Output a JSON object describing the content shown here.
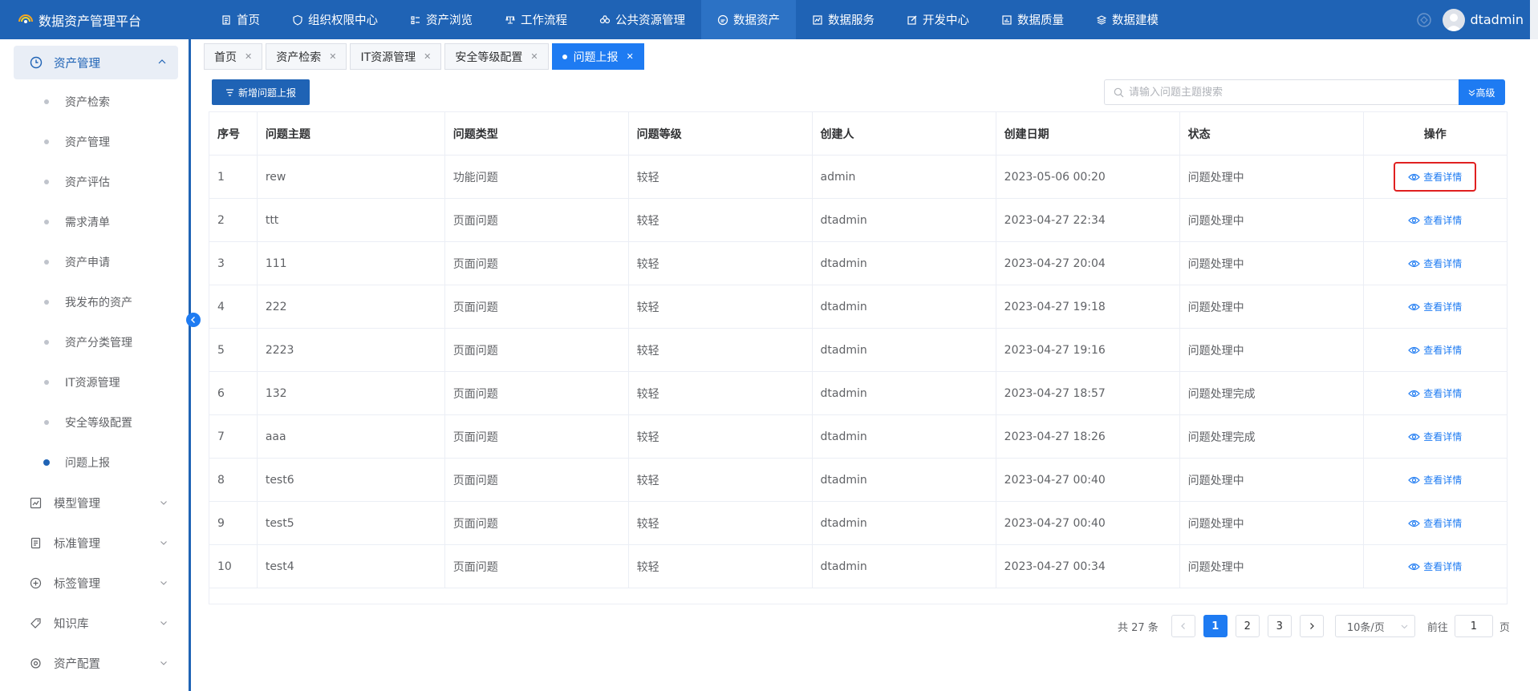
{
  "app": {
    "title": "数据资产管理平台"
  },
  "topnav": [
    {
      "label": "首页",
      "icon": "document-icon"
    },
    {
      "label": "组织权限中心",
      "icon": "shield-icon"
    },
    {
      "label": "资产浏览",
      "icon": "list-icon"
    },
    {
      "label": "工作流程",
      "icon": "flow-icon"
    },
    {
      "label": "公共资源管理",
      "icon": "resource-icon"
    },
    {
      "label": "数据资产",
      "icon": "asset-icon",
      "active": true
    },
    {
      "label": "数据服务",
      "icon": "service-icon"
    },
    {
      "label": "开发中心",
      "icon": "edit-icon"
    },
    {
      "label": "数据质量",
      "icon": "chart-icon"
    },
    {
      "label": "数据建模",
      "icon": "layers-icon"
    }
  ],
  "user": {
    "name": "dtadmin"
  },
  "sidebar": {
    "group": {
      "label": "资产管理",
      "icon": "clock-icon"
    },
    "sub_items": [
      "资产检索",
      "资产管理",
      "资产评估",
      "需求清单",
      "资产申请",
      "我发布的资产",
      "资产分类管理",
      "IT资源管理",
      "安全等级配置",
      "问题上报"
    ],
    "active_sub": "问题上报",
    "menus": [
      {
        "label": "模型管理",
        "icon": "trend-icon"
      },
      {
        "label": "标准管理",
        "icon": "doc-icon"
      },
      {
        "label": "标签管理",
        "icon": "plus-circle-icon"
      },
      {
        "label": "知识库",
        "icon": "tag-icon"
      },
      {
        "label": "资产配置",
        "icon": "settings-icon"
      }
    ]
  },
  "tabs": [
    {
      "label": "首页"
    },
    {
      "label": "资产检索"
    },
    {
      "label": "IT资源管理"
    },
    {
      "label": "安全等级配置"
    },
    {
      "label": "问题上报",
      "active": true
    }
  ],
  "toolbar": {
    "add_label": "新增问题上报",
    "search_placeholder": "请输入问题主题搜索",
    "advanced_label": "高级"
  },
  "table": {
    "headers": [
      "序号",
      "问题主题",
      "问题类型",
      "问题等级",
      "创建人",
      "创建日期",
      "状态",
      "操作"
    ],
    "action_label": "查看详情",
    "rows": [
      [
        "1",
        "rew",
        "功能问题",
        "较轻",
        "admin",
        "2023-05-06 00:20",
        "问题处理中"
      ],
      [
        "2",
        "ttt",
        "页面问题",
        "较轻",
        "dtadmin",
        "2023-04-27 22:34",
        "问题处理中"
      ],
      [
        "3",
        "111",
        "页面问题",
        "较轻",
        "dtadmin",
        "2023-04-27 20:04",
        "问题处理中"
      ],
      [
        "4",
        "222",
        "页面问题",
        "较轻",
        "dtadmin",
        "2023-04-27 19:18",
        "问题处理中"
      ],
      [
        "5",
        "2223",
        "页面问题",
        "较轻",
        "dtadmin",
        "2023-04-27 19:16",
        "问题处理中"
      ],
      [
        "6",
        "132",
        "页面问题",
        "较轻",
        "dtadmin",
        "2023-04-27 18:57",
        "问题处理完成"
      ],
      [
        "7",
        "aaa",
        "页面问题",
        "较轻",
        "dtadmin",
        "2023-04-27 18:26",
        "问题处理完成"
      ],
      [
        "8",
        "test6",
        "页面问题",
        "较轻",
        "dtadmin",
        "2023-04-27 00:40",
        "问题处理中"
      ],
      [
        "9",
        "test5",
        "页面问题",
        "较轻",
        "dtadmin",
        "2023-04-27 00:40",
        "问题处理中"
      ],
      [
        "10",
        "test4",
        "页面问题",
        "较轻",
        "dtadmin",
        "2023-04-27 00:34",
        "问题处理中"
      ]
    ]
  },
  "pagination": {
    "total_label": "共 27 条",
    "pages": [
      "1",
      "2",
      "3"
    ],
    "current": "1",
    "page_size": "10条/页",
    "goto_prefix": "前往",
    "goto_value": "1",
    "goto_suffix": "页"
  },
  "colors": {
    "header_bg": "#1f63b5",
    "accent": "#1e7bf2",
    "highlight": "#e02020"
  }
}
